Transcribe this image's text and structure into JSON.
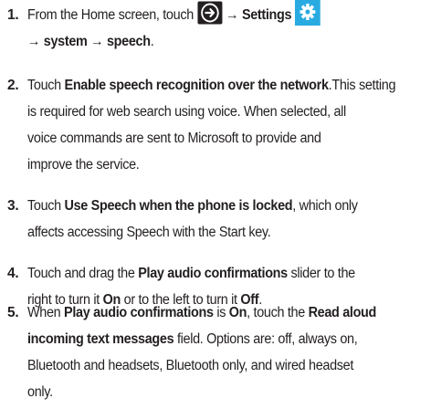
{
  "steps": [
    {
      "number": "1.",
      "line1_before_icon": "From the Home screen, touch ",
      "arrow_icon": "arrow-right-circle-icon",
      "line1_arrow": " → ",
      "line1_bold": "Settings",
      "settings_icon": "gear-icon",
      "line2_arrow1": "→ ",
      "line2_bold1": "system",
      "line2_arrow2": " → ",
      "line2_bold2": "speech",
      "line2_end": "."
    },
    {
      "number": "2.",
      "line1_pre": "Touch ",
      "line1_bold": "Enable speech recognition over the network",
      "line1_post": ".This setting",
      "line2": "is required for web search using voice. When selected, all",
      "line3": "voice commands are sent to Microsoft to provide and",
      "line4": "improve the service."
    },
    {
      "number": "3.",
      "line1_pre": "Touch ",
      "line1_bold": "Use Speech when the phone is locked",
      "line1_post": ", which only",
      "line2": "affects accessing Speech with the Start key."
    },
    {
      "number": "4.",
      "line1_pre": "Touch and drag the ",
      "line1_bold": "Play audio confirmations",
      "line1_post": " slider to the",
      "line2_pre": "right to turn it ",
      "line2_bold1": "On",
      "line2_mid": " or to the left to turn it ",
      "line2_bold2": "Off",
      "line2_end": "."
    },
    {
      "number": "5.",
      "line1_pre": "When ",
      "line1_bold1": "Play audio confirmations",
      "line1_mid": " is ",
      "line1_bold2": "On",
      "line1_mid2": ", touch the ",
      "line1_bold3": "Read aloud",
      "line2_bold": "incoming text messages",
      "line2_post": " field. Options are: off, always on,",
      "line3": "Bluetooth and headsets, Bluetooth only, and wired headset",
      "line4": "only."
    }
  ],
  "colors": {
    "text": "#231f20",
    "arrow_icon_bg": "#231f20",
    "arrow_icon_fg": "#ffffff",
    "settings_icon_bg": "#29abe2",
    "settings_icon_fg": "#ffffff"
  }
}
